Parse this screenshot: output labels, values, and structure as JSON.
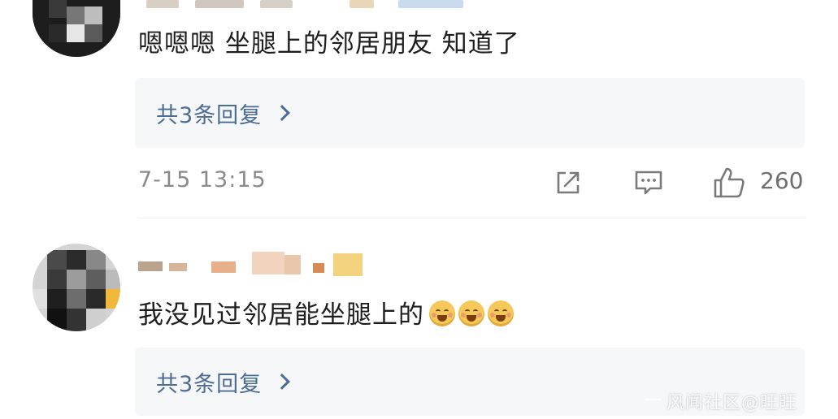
{
  "comments": [
    {
      "text": "嗯嗯嗯 坐腿上的邻居朋友 知道了",
      "replies_label": "共3条回复",
      "timestamp": "7-15 13:15",
      "like_count": "260"
    },
    {
      "text": "我没见过邻居能坐腿上的",
      "emojis": [
        "scared-face-emoji",
        "scared-face-emoji",
        "scared-face-emoji"
      ],
      "replies_label": "共3条回复"
    }
  ],
  "icons": {
    "share": "share-icon",
    "comment": "comment-icon",
    "like": "thumbs-up-icon",
    "chevron": "chevron-right-icon"
  },
  "colors": {
    "link": "#4b6c94",
    "reply_box_bg": "#f6f7f9",
    "meta_text": "#8a8a8a",
    "emoji": "#f5c85a"
  },
  "watermark": "风闻社区@旺旺"
}
